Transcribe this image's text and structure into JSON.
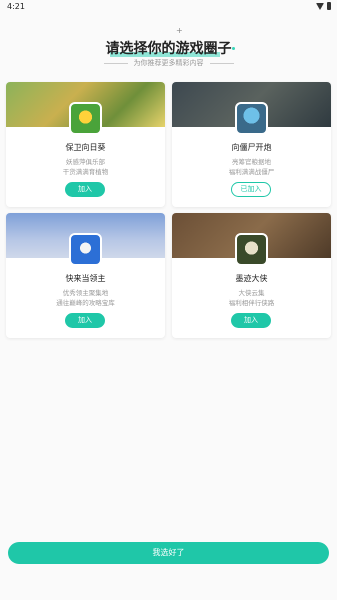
{
  "status": {
    "time": "4:21"
  },
  "header": {
    "title": "请选择你的游戏圈子",
    "subtitle": "为你推荐更多精彩内容"
  },
  "cards": [
    {
      "name": "保卫向日葵",
      "desc1": "妖感萍俱乐部",
      "desc2": "干货满满育植物",
      "button": "加入",
      "joined": false
    },
    {
      "name": "向僵尸开炮",
      "desc1": "亮筹官粮据地",
      "desc2": "福利满满战僵尸",
      "button": "已加入",
      "joined": true
    },
    {
      "name": "快来当领主",
      "desc1": "优秀领主聚集地",
      "desc2": "通往巅峰的攻略宝库",
      "button": "加入",
      "joined": false
    },
    {
      "name": "墨迹大侠",
      "desc1": "大侠云集",
      "desc2": "福利相伴行侠路",
      "button": "加入",
      "joined": false
    }
  ],
  "footer": {
    "confirm_label": "我选好了"
  },
  "colors": {
    "accent": "#1fc7a8"
  },
  "icons": [
    "wifi-icon",
    "battery-icon"
  ]
}
